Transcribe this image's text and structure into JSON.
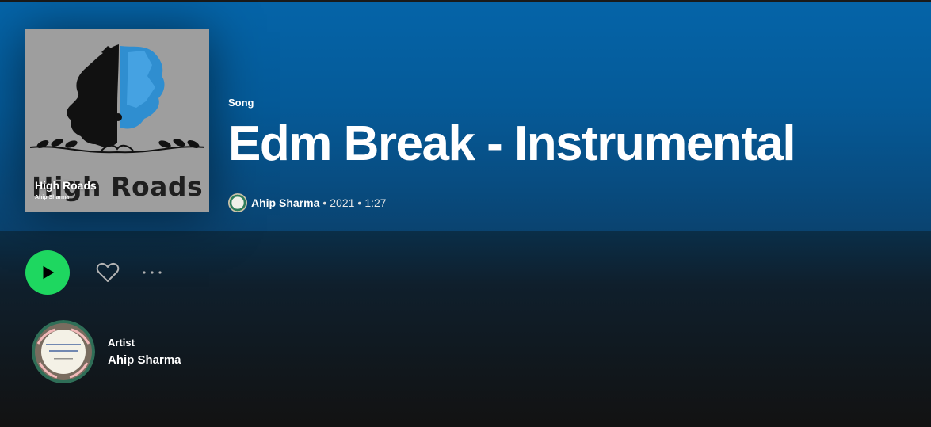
{
  "header": {
    "type_label": "Song",
    "title": "Edm Break - Instrumental",
    "artist": "Ahip Sharma",
    "year": "2021",
    "duration": "1:27"
  },
  "cover": {
    "art_text": "High Roads",
    "title": "High Roads",
    "subtitle": "Ahip Sharma"
  },
  "actions": {
    "play_icon": "play-icon",
    "like_icon": "heart-icon",
    "more_icon": "more-options-icon"
  },
  "artist_card": {
    "kind_label": "Artist",
    "name": "Ahip Sharma"
  },
  "colors": {
    "header_blue": "#055a98",
    "play_green": "#1ed760",
    "background": "#121212"
  }
}
